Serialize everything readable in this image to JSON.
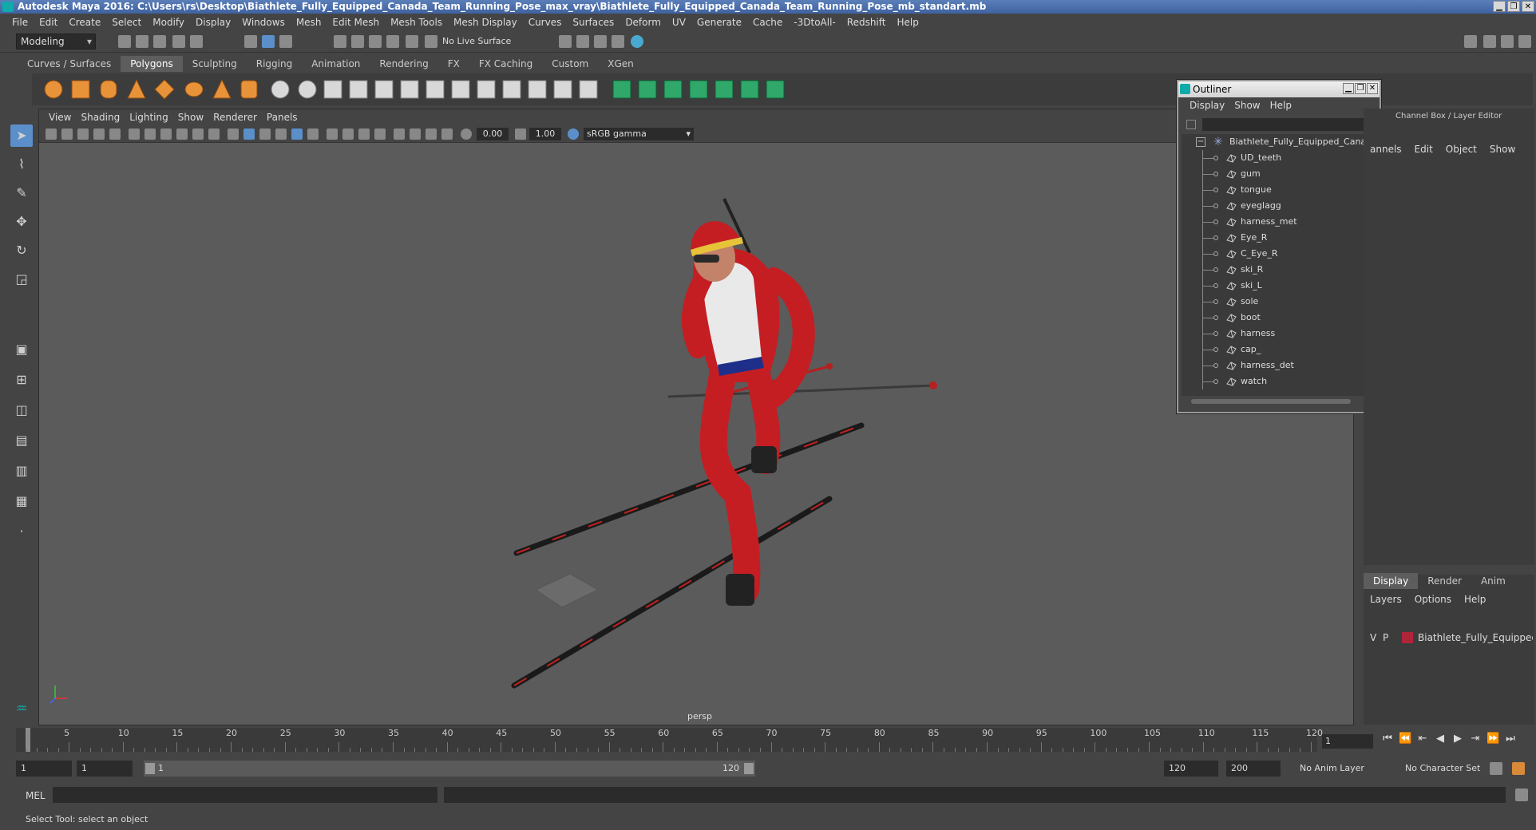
{
  "window": {
    "title": "Autodesk Maya 2016: C:\\Users\\rs\\Desktop\\Biathlete_Fully_Equipped_Canada_Team_Running_Pose_max_vray\\Biathlete_Fully_Equipped_Canada_Team_Running_Pose_mb_standart.mb",
    "controls": [
      "▁",
      "❐",
      "✕"
    ]
  },
  "menubar": [
    "File",
    "Edit",
    "Create",
    "Select",
    "Modify",
    "Display",
    "Windows",
    "Mesh",
    "Edit Mesh",
    "Mesh Tools",
    "Mesh Display",
    "Curves",
    "Surfaces",
    "Deform",
    "UV",
    "Generate",
    "Cache",
    "-3DtoAll-",
    "Redshift",
    "Help"
  ],
  "statusline": {
    "mode": "Modeling",
    "live_surface": "No Live Surface"
  },
  "shelf": {
    "tabs": [
      "Curves / Surfaces",
      "Polygons",
      "Sculpting",
      "Rigging",
      "Animation",
      "Rendering",
      "FX",
      "FX Caching",
      "Custom",
      "XGen"
    ],
    "active_tab": "Polygons"
  },
  "viewport": {
    "menu": [
      "View",
      "Shading",
      "Lighting",
      "Show",
      "Renderer",
      "Panels"
    ],
    "exposure": "0.00",
    "gamma_value": "1.00",
    "color_space": "sRGB gamma",
    "camera_label": "persp"
  },
  "outliner": {
    "title": "Outliner",
    "menu": [
      "Display",
      "Show",
      "Help"
    ],
    "root": "Biathlete_Fully_Equipped_Canada",
    "items": [
      "UD_teeth",
      "gum",
      "tongue",
      "eyeglagg",
      "harness_met",
      "Eye_R",
      "C_Eye_R",
      "ski_R",
      "ski_L",
      "sole",
      "boot",
      "harness",
      "cap_",
      "harness_det",
      "watch"
    ]
  },
  "channelbox": {
    "title": "Channel Box / Layer Editor",
    "menu": [
      "annels",
      "Edit",
      "Object",
      "Show"
    ]
  },
  "layer_editor": {
    "tabs": [
      "Display",
      "Render",
      "Anim"
    ],
    "active_tab": "Display",
    "menu": [
      "Layers",
      "Options",
      "Help"
    ],
    "layer": {
      "v": "V",
      "p": "P",
      "name": "Biathlete_Fully_Equipped_C",
      "color": "#b0243a"
    }
  },
  "timeline": {
    "start": 1,
    "end": 120,
    "ticks": [
      "5",
      "10",
      "15",
      "20",
      "25",
      "30",
      "35",
      "40",
      "45",
      "50",
      "55",
      "60",
      "65",
      "70",
      "75",
      "80",
      "85",
      "90",
      "95",
      "100",
      "105",
      "110",
      "115",
      "120"
    ],
    "first_label": "1",
    "current_frame": "1",
    "playback": [
      "⏮",
      "⏪",
      "⇤",
      "◀",
      "▶",
      "⇥",
      "⏩",
      "⏭"
    ]
  },
  "range": {
    "start_field": "1",
    "start_field2": "1",
    "slider_lo": "1",
    "slider_hi": "120",
    "end_field": "120",
    "end_field2": "200",
    "anim_layer": "No Anim Layer",
    "char_set": "No Character Set"
  },
  "cmdline": {
    "label": "MEL"
  },
  "helpline": "Select Tool: select an object"
}
